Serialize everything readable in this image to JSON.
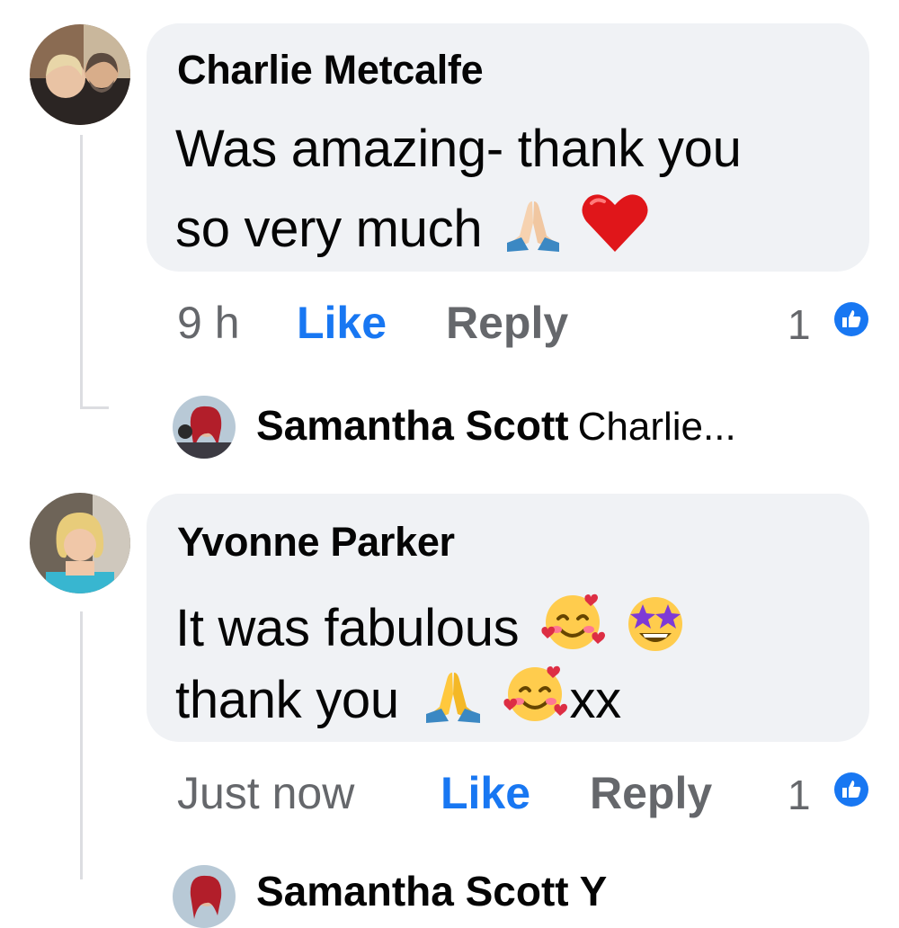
{
  "comments": [
    {
      "author": "Charlie Metcalfe",
      "line1": "Was amazing- thank you",
      "line2": "so very much",
      "line2_emojis": [
        "folded-hands",
        "red-heart"
      ],
      "time": "9 h",
      "like_label": "Like",
      "reply_label": "Reply",
      "reaction_count": "1",
      "reply_preview": {
        "author": "Samantha Scott",
        "text": "Charlie..."
      }
    },
    {
      "author": "Yvonne Parker",
      "line1": "It was fabulous",
      "line1_emojis": [
        "smiling-face-with-hearts",
        "star-struck"
      ],
      "line2": "thank you",
      "line2_emojis": [
        "folded-hands",
        "smiling-face-with-hearts"
      ],
      "line2_suffix": "xx",
      "time": "Just now",
      "like_label": "Like",
      "reply_label": "Reply",
      "reaction_count": "1",
      "reply_preview": {
        "author": "Samantha Scott Y"
      }
    }
  ],
  "colors": {
    "bubble": "#f0f2f5",
    "meta": "#65676b",
    "like": "#1877f2",
    "thread_line": "#dcdde1"
  }
}
